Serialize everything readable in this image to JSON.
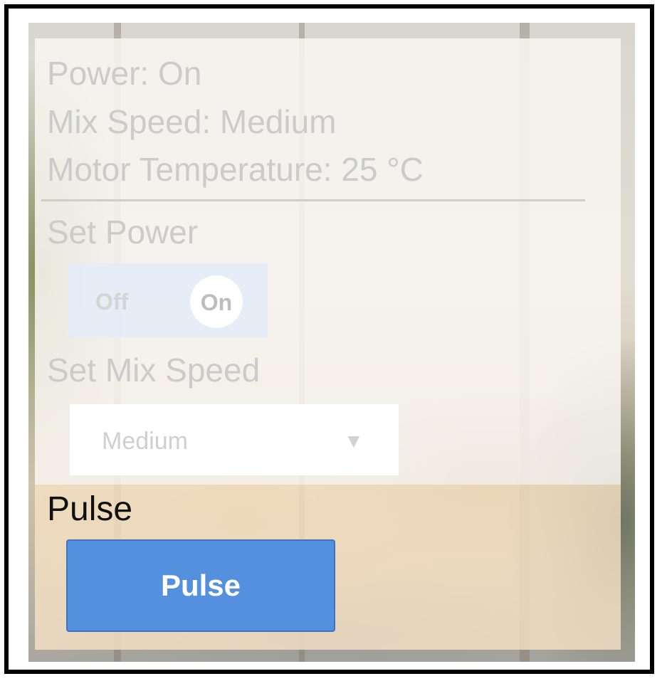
{
  "status": {
    "power": "Power: On",
    "mix_speed": "Mix Speed: Medium",
    "motor_temperature": "Motor Temperature: 25 °C"
  },
  "set_power": {
    "label": "Set Power",
    "off_label": "Off",
    "on_label": "On",
    "state": "On"
  },
  "set_mix_speed": {
    "label": "Set Mix Speed",
    "selected": "Medium",
    "arrow": "▼"
  },
  "pulse": {
    "label": "Pulse",
    "button_label": "Pulse",
    "button_color": "#5590df"
  }
}
